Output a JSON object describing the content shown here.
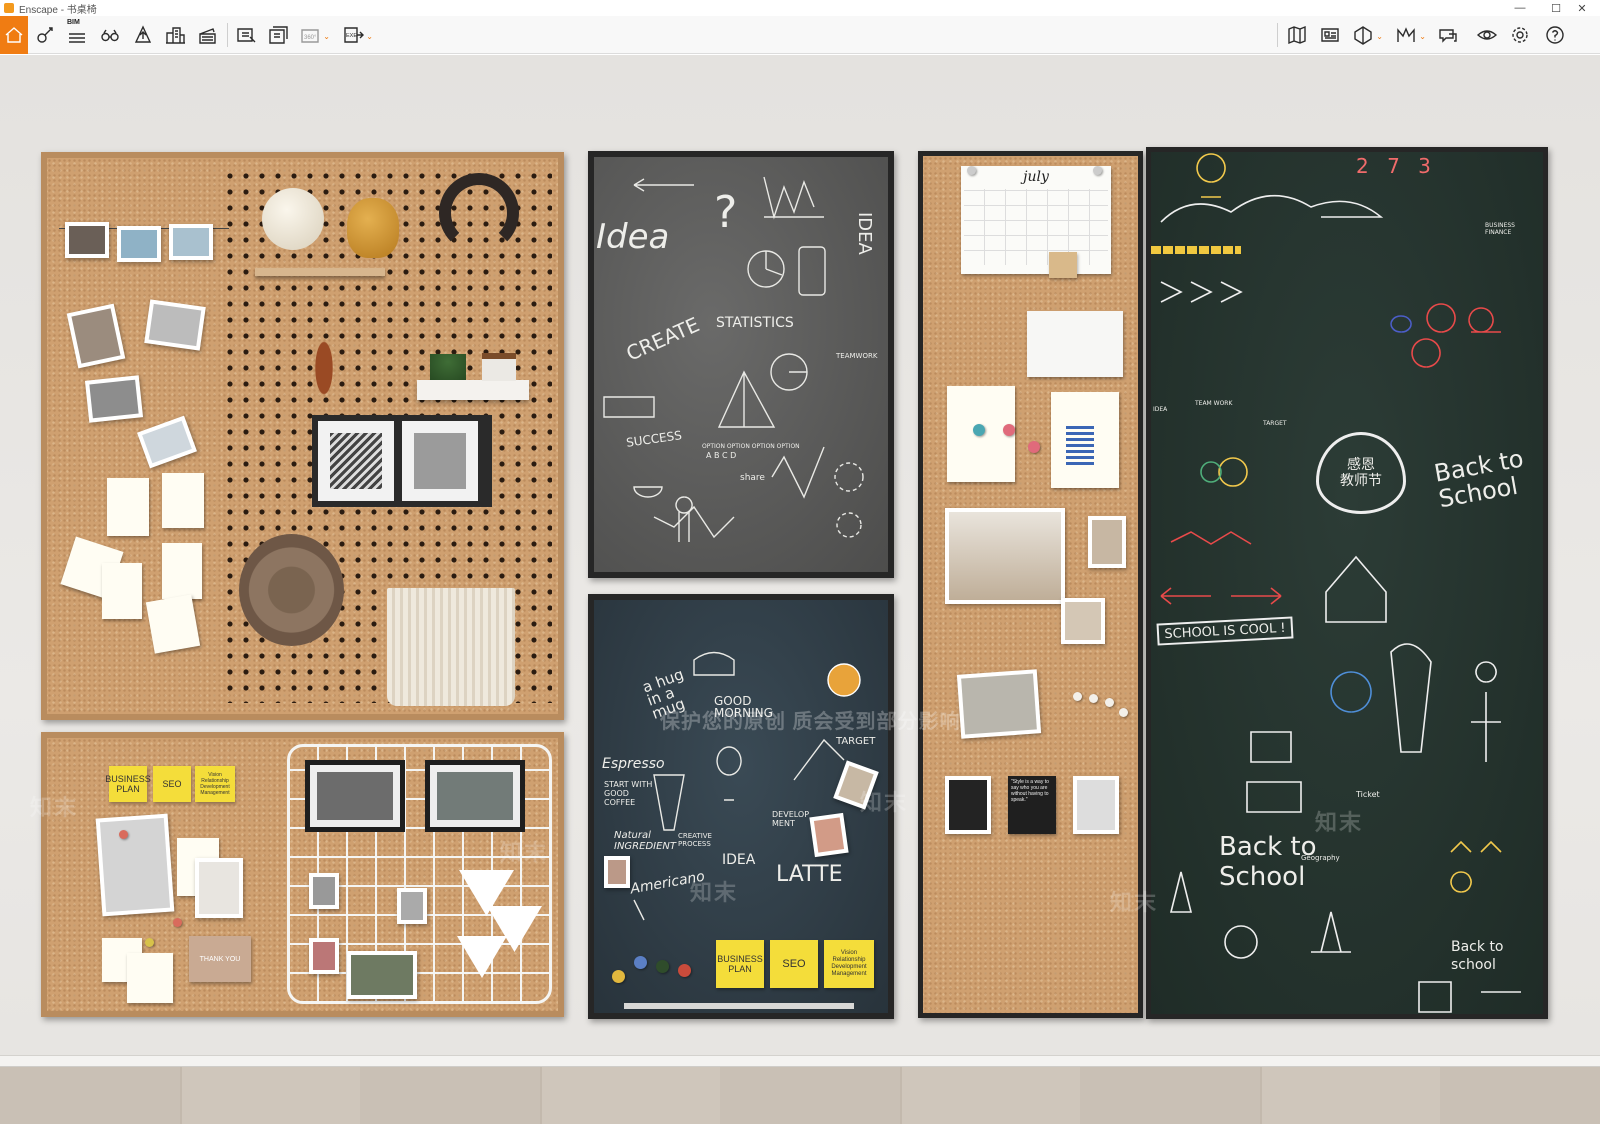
{
  "window": {
    "title": "Enscape - 书桌椅",
    "minimize": "—",
    "maximize": "☐",
    "close": "✕"
  },
  "toolbar": {
    "left": [
      "home-icon",
      "asset-library-icon",
      "bim-icon",
      "binoculars-icon",
      "upload-icon",
      "buildings-icon",
      "clapperboard-icon",
      "screenshot-icon",
      "batch-render-icon",
      "panorama-icon",
      "exe-export-icon"
    ],
    "bim_label": "BIM",
    "panorama_label": "360°",
    "exe_label": "EXE",
    "right": [
      "map-icon",
      "view-management-icon",
      "section-icon",
      "material-editor-icon",
      "feedback-icon",
      "visual-settings-icon",
      "settings-icon",
      "help-icon"
    ],
    "collapse": "⌃",
    "accent": "#f07c12"
  },
  "scene": {
    "chalk_grey": {
      "idea": "Idea",
      "create": "CREATE",
      "statistics": "STATISTICS",
      "teamwork": "TEAMWORK",
      "success": "SUCCESS",
      "options": "OPTION  OPTION  OPTION  OPTION",
      "abcd": "A     B     C     D",
      "share": "share",
      "idea_vertical": "IDEA"
    },
    "chalk_navy": {
      "hug": "a hug in a mug",
      "good_morning": "GOOD MORNING",
      "target": "TARGET",
      "espresso": "Espresso",
      "start": "START WITH GOOD COFFEE",
      "natural": "Natural INGREDIENT",
      "creative": "CREATIVE PROCESS",
      "develop": "DEVELOP MENT",
      "idea": "IDEA",
      "latte": "LATTE",
      "americano": "Americano",
      "watermark": "保护您的原创 质会受到部分影响"
    },
    "stickies_navy": [
      "BUSINESS PLAN",
      "SEO",
      "Vision Relationship Development Management"
    ],
    "stickies_cork": [
      "BUSINESS PLAN",
      "SEO",
      "Vision Relationship Development Management"
    ],
    "cork_notes": {
      "thank_you": "THANK YOU",
      "july": "july",
      "story": "\"Style is a way to say who you are without having to speak.\""
    },
    "chalk_green": {
      "school_cool": "SCHOOL IS COOL !",
      "back_to_school": "Back to School",
      "back_to_school_small": "Back to school",
      "heart": "感恩 教师节",
      "team_work": "TEAM WORK",
      "target": "TARGET",
      "idea": "IDEA",
      "geography": "Geography",
      "ticket": "Ticket",
      "business": "BUSINESS FINANCE",
      "numbers": "2 7 3"
    },
    "watermark": "知末"
  }
}
